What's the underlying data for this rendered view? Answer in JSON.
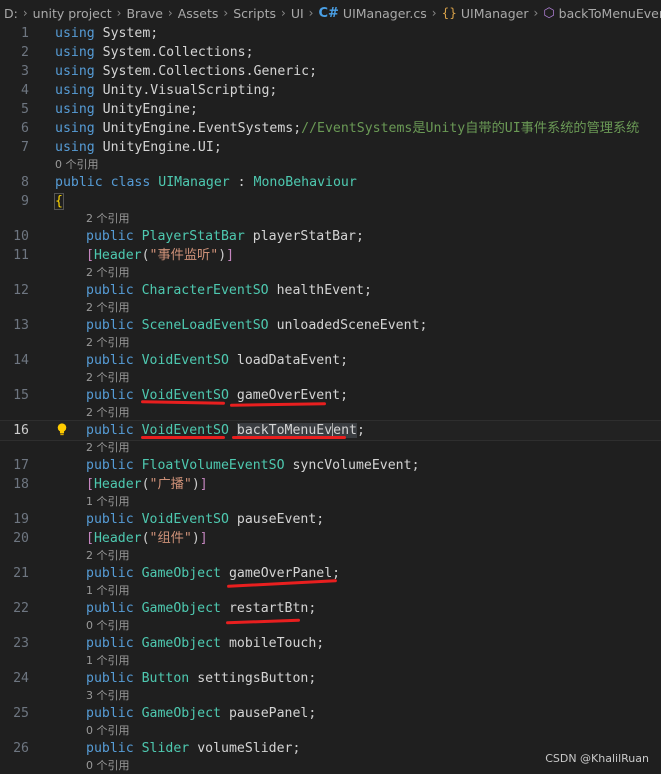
{
  "breadcrumb": {
    "items": [
      "D:",
      "unity project",
      "Brave",
      "Assets",
      "Scripts",
      "UI",
      "UIManager.cs",
      "UIManager",
      "backToMenuEvent"
    ]
  },
  "lines": {
    "l1": {
      "num": "1",
      "kw": "using",
      "ns": "System",
      "end": ";"
    },
    "l2": {
      "num": "2",
      "kw": "using",
      "ns": "System.Collections",
      "end": ";"
    },
    "l3": {
      "num": "3",
      "kw": "using",
      "ns": "System.Collections.Generic",
      "end": ";"
    },
    "l4": {
      "num": "4",
      "kw": "using",
      "ns": "Unity.VisualScripting",
      "end": ";"
    },
    "l5": {
      "num": "5",
      "kw": "using",
      "ns": "UnityEngine",
      "end": ";"
    },
    "l6": {
      "num": "6",
      "kw": "using",
      "ns": "UnityEngine.EventSystems",
      "end": ";",
      "comment": "//EventSystems是Unity自带的UI事件系统的管理系统"
    },
    "l7": {
      "num": "7",
      "kw": "using",
      "ns": "UnityEngine.UI",
      "end": ";"
    },
    "r7": "0 个引用",
    "l8": {
      "num": "8",
      "kw1": "public",
      "kw2": "class",
      "cls": "UIManager",
      "colon": " : ",
      "base": "MonoBehaviour"
    },
    "l9": {
      "num": "9",
      "brace": "{"
    },
    "r9": "2 个引用",
    "l10": {
      "num": "10",
      "kw": "public",
      "type": "PlayerStatBar",
      "name": "playerStatBar",
      "end": ";"
    },
    "l11": {
      "num": "11",
      "attr": "Header",
      "arg": "\"事件监听\""
    },
    "r11": "2 个引用",
    "l12": {
      "num": "12",
      "kw": "public",
      "type": "CharacterEventSO",
      "name": "healthEvent",
      "end": ";"
    },
    "r12": "2 个引用",
    "l13": {
      "num": "13",
      "kw": "public",
      "type": "SceneLoadEventSO",
      "name": "unloadedSceneEvent",
      "end": ";"
    },
    "r13": "2 个引用",
    "l14": {
      "num": "14",
      "kw": "public",
      "type": "VoidEventSO",
      "name": "loadDataEvent",
      "end": ";"
    },
    "r14": "2 个引用",
    "l15": {
      "num": "15",
      "kw": "public",
      "type": "VoidEventSO",
      "name": "gameOverEvent",
      "end": ";"
    },
    "r15": "2 个引用",
    "l16": {
      "num": "16",
      "kw": "public",
      "type": "VoidEventSO",
      "name_a": "backToMenuEv",
      "name_b": "ent",
      "end": ";"
    },
    "r16": "2 个引用",
    "l17": {
      "num": "17",
      "kw": "public",
      "type": "FloatVolumeEventSO",
      "name": "syncVolumeEvent",
      "end": ";"
    },
    "l18": {
      "num": "18",
      "attr": "Header",
      "arg": "\"广播\""
    },
    "r18": "1 个引用",
    "l19": {
      "num": "19",
      "kw": "public",
      "type": "VoidEventSO",
      "name": "pauseEvent",
      "end": ";"
    },
    "l20": {
      "num": "20",
      "attr": "Header",
      "arg": "\"组件\""
    },
    "r20": "2 个引用",
    "l21": {
      "num": "21",
      "kw": "public",
      "type": "GameObject",
      "name": "gameOverPanel",
      "end": ";"
    },
    "r21": "1 个引用",
    "l22": {
      "num": "22",
      "kw": "public",
      "type": "GameObject",
      "name": "restartBtn",
      "end": ";"
    },
    "r22": "0 个引用",
    "l23": {
      "num": "23",
      "kw": "public",
      "type": "GameObject",
      "name": "mobileTouch",
      "end": ";"
    },
    "r23": "1 个引用",
    "l24": {
      "num": "24",
      "kw": "public",
      "type": "Button",
      "name": "settingsButton",
      "end": ";"
    },
    "r24": "3 个引用",
    "l25": {
      "num": "25",
      "kw": "public",
      "type": "GameObject",
      "name": "pausePanel",
      "end": ";"
    },
    "r25": "0 个引用",
    "l26": {
      "num": "26",
      "kw": "public",
      "type": "Slider",
      "name": "volumeSlider",
      "end": ";"
    },
    "r26": "0 个引用"
  },
  "watermark": "CSDN @KhalilRuan",
  "colors": {
    "annotation": "#e81f1f",
    "keyword": "#569cd6",
    "type": "#4ec9b0",
    "comment": "#6a9955",
    "string": "#ce9178"
  }
}
